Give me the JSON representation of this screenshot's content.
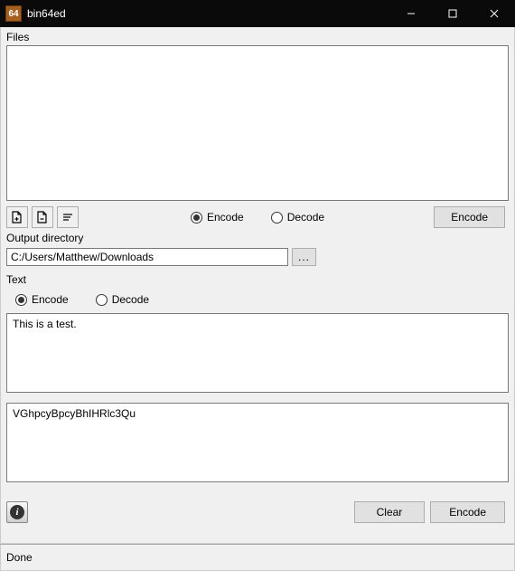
{
  "window": {
    "title": "bin64ed",
    "icon_text": "64"
  },
  "files": {
    "label": "Files",
    "radio_encode": "Encode",
    "radio_decode": "Decode",
    "selected": "encode",
    "action_button": "Encode"
  },
  "output_dir": {
    "label": "Output directory",
    "value": "C:/Users/Matthew/Downloads",
    "browse": "..."
  },
  "text": {
    "label": "Text",
    "radio_encode": "Encode",
    "radio_decode": "Decode",
    "selected": "encode",
    "input_value": "This is a test.",
    "output_value": "VGhpcyBpcyBhIHRlc3Qu",
    "clear_button": "Clear",
    "action_button": "Encode"
  },
  "status": {
    "text": "Done"
  }
}
